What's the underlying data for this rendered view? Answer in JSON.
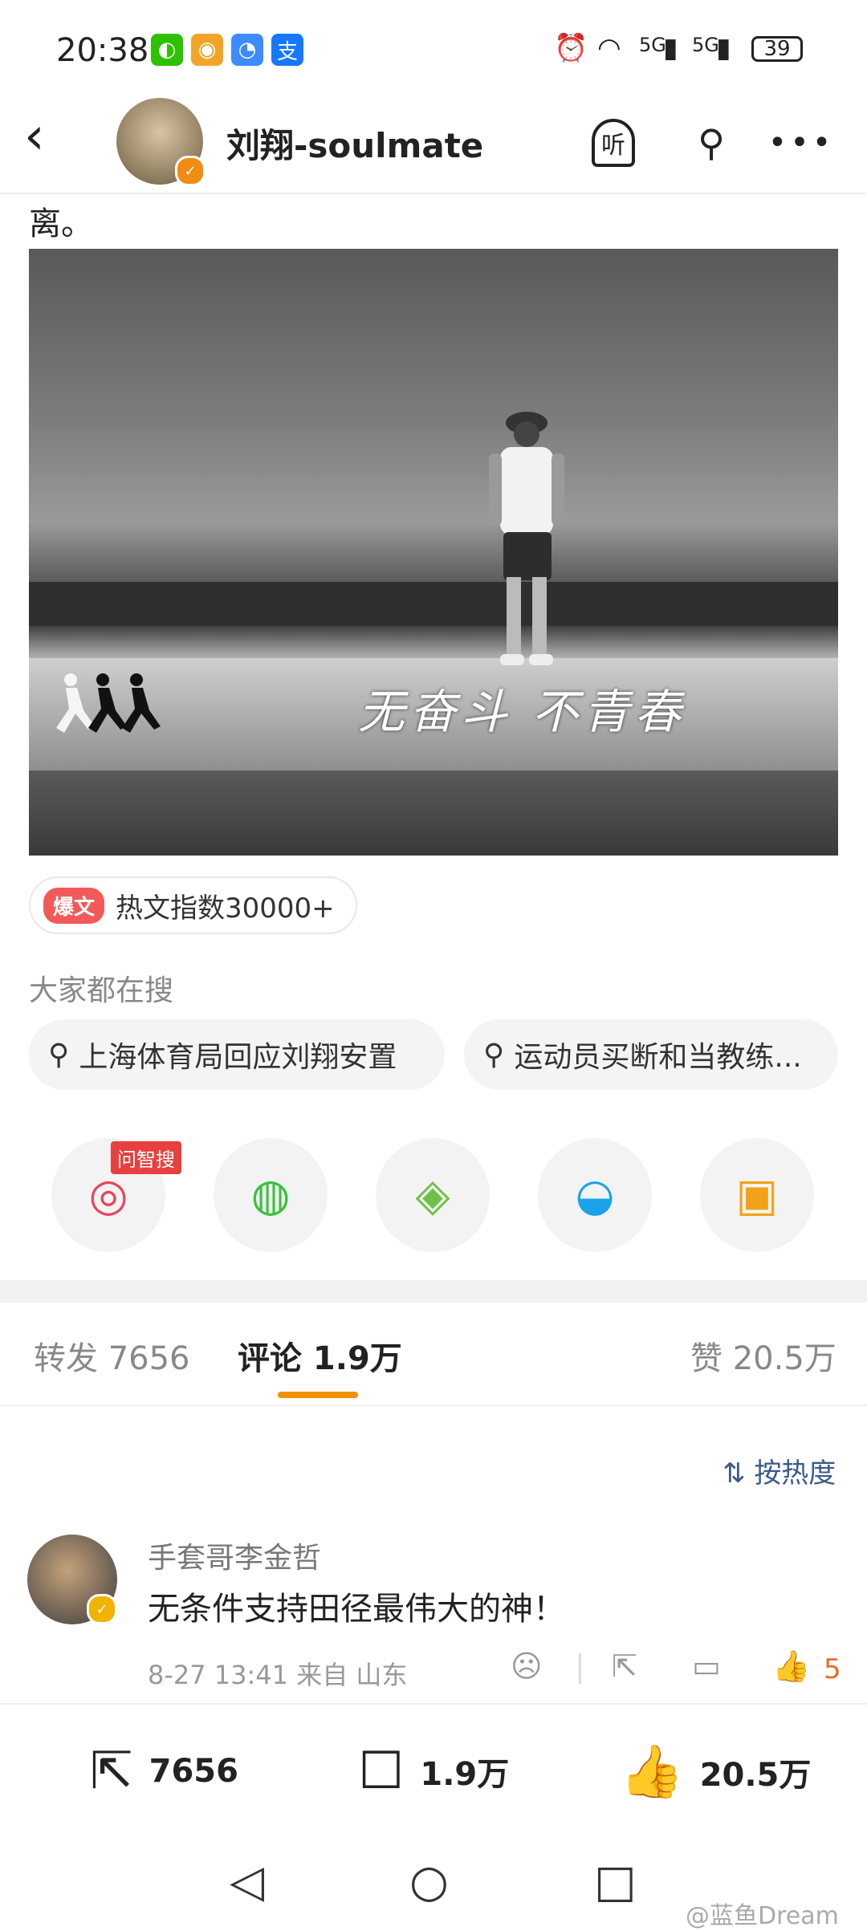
{
  "status": {
    "time": "20:38",
    "apps": [
      {
        "name": "wechat-icon",
        "glyph": "◐",
        "color": "#2dc100"
      },
      {
        "name": "weibo-icon",
        "glyph": "◉",
        "color": "#f3a427"
      },
      {
        "name": "message-icon",
        "glyph": "◔",
        "color": "#3d8bff"
      },
      {
        "name": "alipay-icon",
        "glyph": "支",
        "color": "#1677ff"
      }
    ],
    "signal1": "5G",
    "signal2": "5G",
    "battery": "39"
  },
  "header": {
    "username": "刘翔-soulmate",
    "listen_label": "听"
  },
  "post": {
    "text": "离。",
    "photo_slogan": "无奋斗 不青春",
    "hot_badge": "爆文",
    "hot_text": "热文指数30000+"
  },
  "search": {
    "title": "大家都在搜",
    "items": [
      "上海体育局回应刘翔安置",
      "运动员买断和当教练..."
    ]
  },
  "share": {
    "wenzhisou_label": "问智搜",
    "items": [
      {
        "name": "wenzhisou-icon",
        "glyph": "◎",
        "color": "#e8445a"
      },
      {
        "name": "wechat-share-icon",
        "glyph": "◍",
        "color": "#38c23d"
      },
      {
        "name": "moments-icon",
        "glyph": "◈",
        "color": "#6fc146"
      },
      {
        "name": "qq-icon",
        "glyph": "◒",
        "color": "#1aa3e8"
      },
      {
        "name": "save-image-icon",
        "glyph": "▣",
        "color": "#f2a218"
      }
    ]
  },
  "tabs": {
    "repost": "转发 7656",
    "comments": "评论 1.9万",
    "likes": "赞 20.5万"
  },
  "sort_label": "按热度",
  "comment": {
    "author": "手套哥李金哲",
    "text": "无条件支持田径最伟大的神！",
    "meta": "8-27 13:41  来自 山东",
    "likes": "5"
  },
  "bottom": {
    "repost": "7656",
    "comments": "1.9万",
    "likes": "20.5万"
  },
  "watermark": "@蓝鱼Dream"
}
